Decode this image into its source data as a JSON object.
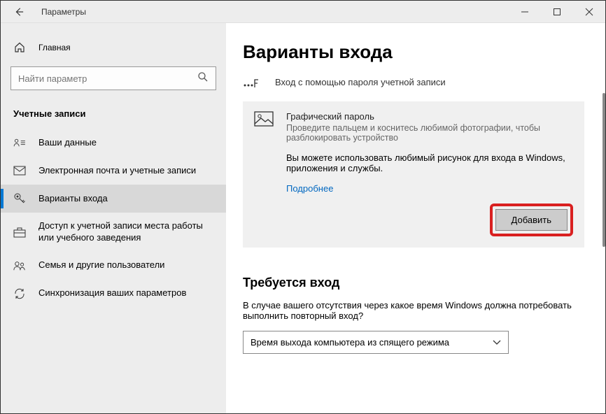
{
  "window": {
    "title": "Параметры"
  },
  "sidebar": {
    "home": "Главная",
    "search_placeholder": "Найти параметр",
    "section": "Учетные записи",
    "items": [
      {
        "label": "Ваши данные"
      },
      {
        "label": "Электронная почта и учетные записи"
      },
      {
        "label": "Варианты входа"
      },
      {
        "label": "Доступ к учетной записи места работы или учебного заведения"
      },
      {
        "label": "Семья и другие пользователи"
      },
      {
        "label": "Синхронизация ваших параметров"
      }
    ]
  },
  "main": {
    "title": "Варианты входа",
    "password_option": {
      "label": "Вход с помощью пароля учетной записи"
    },
    "picture_password": {
      "title": "Графический пароль",
      "subtitle": "Проведите пальцем и коснитесь любимой фотографии, чтобы разблокировать устройство",
      "description": "Вы можете использовать любимый рисунок для входа в Windows, приложения и службы.",
      "learn_more": "Подробнее",
      "add_button": "Добавить"
    },
    "require_signin": {
      "title": "Требуется вход",
      "description": "В случае вашего отсутствия через какое время Windows должна потребовать выполнить повторный вход?",
      "selected": "Время выхода компьютера из спящего режима"
    }
  }
}
